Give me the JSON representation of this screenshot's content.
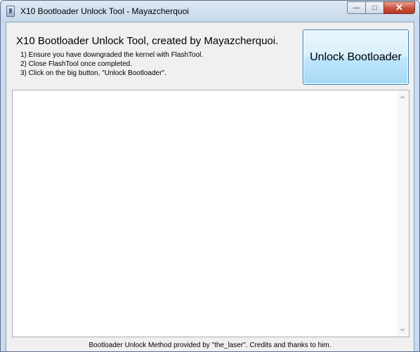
{
  "window": {
    "title": "X10 Bootloader Unlock Tool - Mayazcherquoi",
    "controls": {
      "minimize": "—",
      "maximize": "□",
      "close": "✕"
    }
  },
  "header": {
    "headline": "X10 Bootloader Unlock Tool, created by Mayazcherquoi.",
    "steps": [
      "1) Ensure you have downgraded the kernel with FlashTool.",
      "2) Close FlashTool once completed.",
      "3) Click on the big button, \"Unlock Bootloader\"."
    ]
  },
  "unlock_button": {
    "label": "Unlock Bootloader"
  },
  "log": {
    "text": ""
  },
  "footer": {
    "text": "Bootloader Unlock Method provided by \"the_laser\". Credits and thanks to him."
  },
  "icons": {
    "app": "app-icon",
    "scroll_up": "scroll-up-arrow-icon",
    "scroll_down": "scroll-down-arrow-icon"
  }
}
